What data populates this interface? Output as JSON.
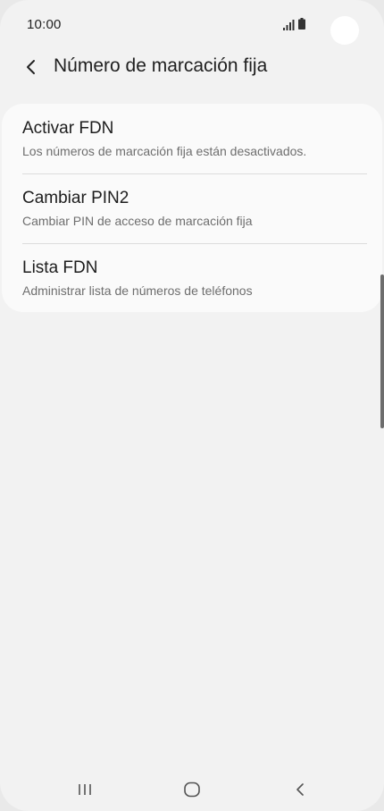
{
  "status_bar": {
    "time": "10:00",
    "icons": [
      "signal-icon",
      "battery-icon"
    ]
  },
  "header": {
    "back_icon": "chevron-left-icon",
    "title": "Número de marcación fija"
  },
  "list": {
    "items": [
      {
        "title": "Activar FDN",
        "subtitle": "Los números de marcación fija están desactivados."
      },
      {
        "title": "Cambiar PIN2",
        "subtitle": "Cambiar PIN de acceso de marcación fija"
      },
      {
        "title": "Lista FDN",
        "subtitle": "Administrar lista de números de teléfonos"
      }
    ]
  },
  "nav_bar": {
    "buttons": [
      "recent-apps-icon",
      "home-icon",
      "back-icon"
    ]
  },
  "colors": {
    "background": "#f2f2f2",
    "card": "#fafafa",
    "title_text": "#1d1d1d",
    "subtitle_text": "#6e6e6e"
  }
}
